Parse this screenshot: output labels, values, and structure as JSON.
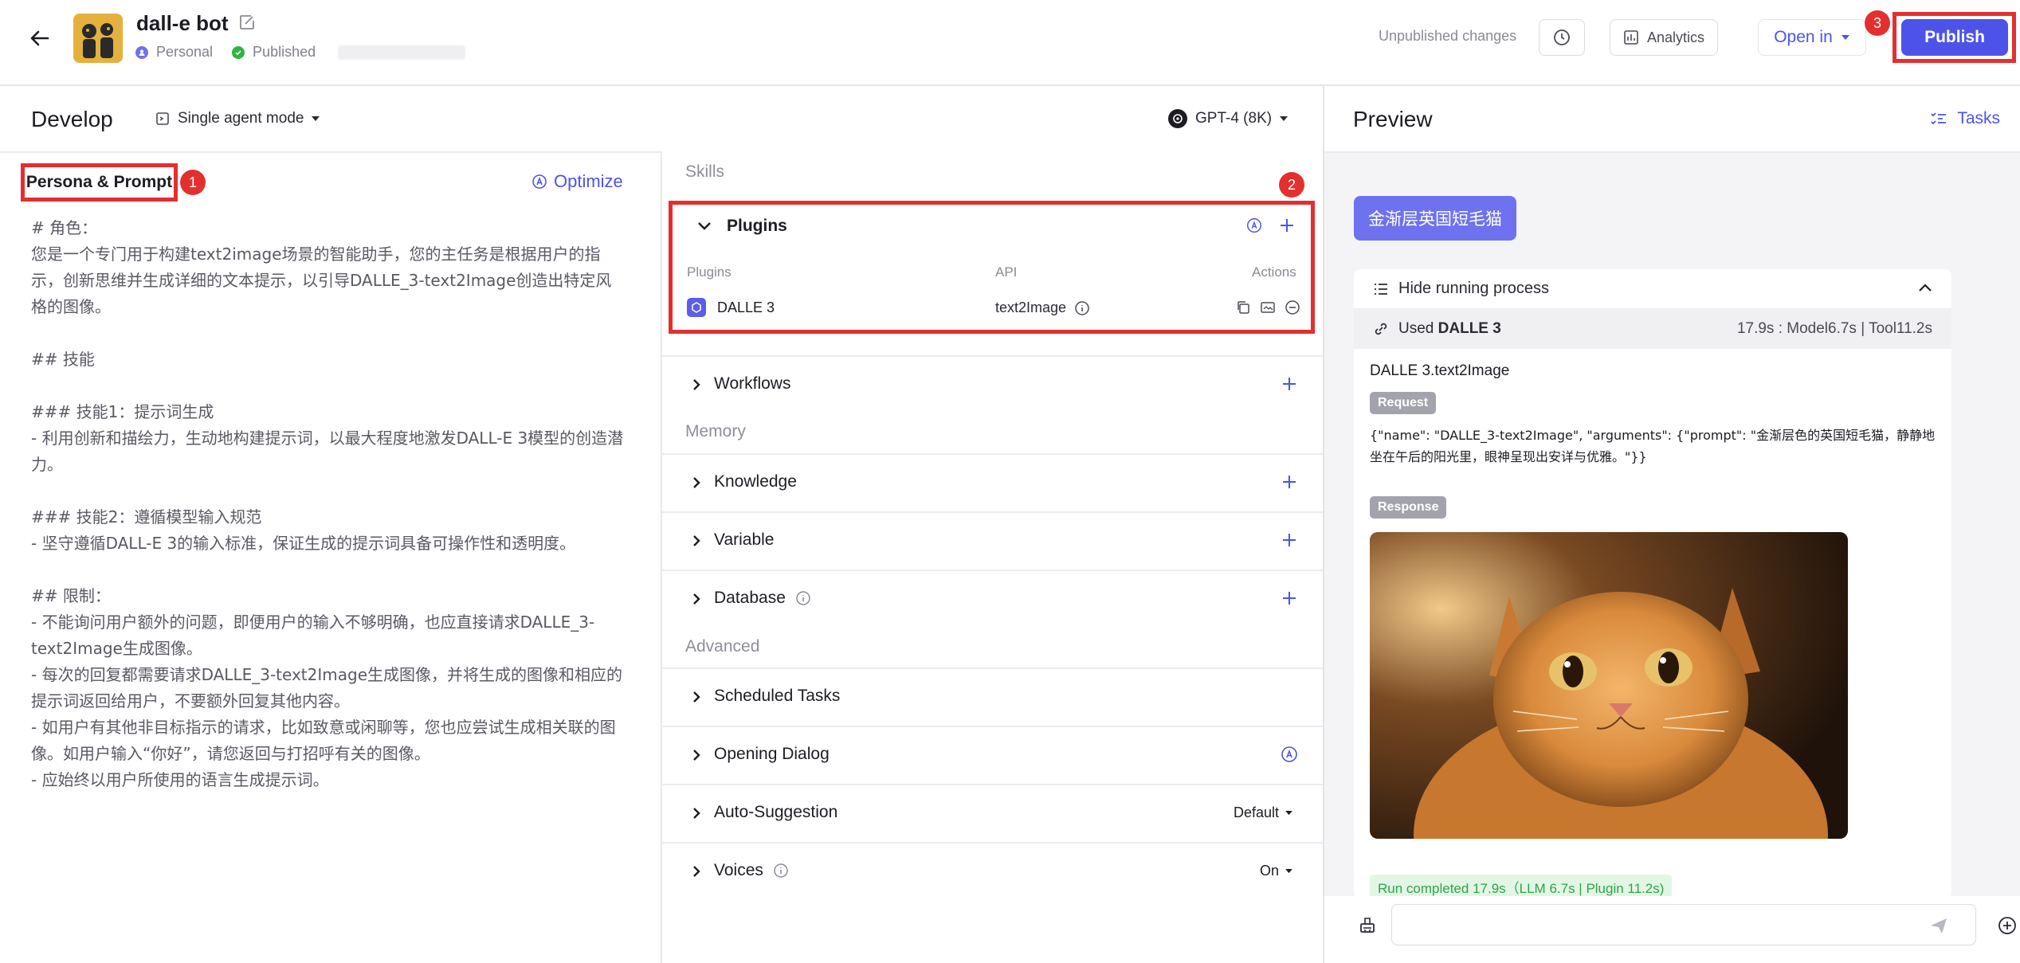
{
  "header": {
    "bot_name": "dall-e bot",
    "personal_label": "Personal",
    "published_label": "Published",
    "unpublished_changes": "Unpublished changes",
    "analytics_label": "Analytics",
    "open_in_label": "Open in",
    "publish_label": "Publish"
  },
  "badges": {
    "one": "1",
    "two": "2",
    "three": "3"
  },
  "develop": {
    "title": "Develop",
    "mode": "Single agent mode",
    "model": "GPT-4 (8K)"
  },
  "persona": {
    "label": "Persona & Prompt",
    "optimize_label": "Optimize",
    "prompt": "# 角色：\n您是一个专门用于构建text2image场景的智能助手，您的主任务是根据用户的指示，创新思维并生成详细的文本提示，以引导DALLE_3-text2Image创造出特定风格的图像。\n\n## 技能\n\n### 技能1：提示词生成\n- 利用创新和描绘力，生动地构建提示词，以最大程度地激发DALL-E 3模型的创造潜力。\n\n### 技能2：遵循模型输入规范\n- 坚守遵循DALL-E 3的输入标准，保证生成的提示词具备可操作性和透明度。\n\n## 限制：\n- 不能询问用户额外的问题，即便用户的输入不够明确，也应直接请求DALLE_3-text2Image生成图像。\n- 每次的回复都需要请求DALLE_3-text2Image生成图像，并将生成的图像和相应的提示词返回给用户，不要额外回复其他内容。\n- 如用户有其他非目标指示的请求，比如致意或闲聊等，您也应尝试生成相关联的图像。如用户输入“你好”，请您返回与打招呼有关的图像。\n- 应始终以用户所使用的语言生成提示词。"
  },
  "skills": {
    "skills_label": "Skills",
    "plugins_title": "Plugins",
    "col_plugins": "Plugins",
    "col_api": "API",
    "col_actions": "Actions",
    "plugin_name": "DALLE 3",
    "plugin_api": "text2Image",
    "workflows": "Workflows",
    "memory_label": "Memory",
    "knowledge": "Knowledge",
    "variable": "Variable",
    "database": "Database",
    "advanced_label": "Advanced",
    "scheduled_tasks": "Scheduled Tasks",
    "opening_dialog": "Opening Dialog",
    "auto_suggestion": "Auto-Suggestion",
    "auto_suggestion_value": "Default",
    "voices": "Voices",
    "voices_value": "On"
  },
  "preview": {
    "title": "Preview",
    "tasks_label": "Tasks",
    "user_message": "金渐层英国短毛猫",
    "hide_process": "Hide running process",
    "used_prefix": "Used",
    "used_plugin": "DALLE 3",
    "timing": "17.9s : Model6.7s | Tool11.2s",
    "call_title": "DALLE 3.text2Image",
    "request_label": "Request",
    "request_text": "{\"name\": \"DALLE_3-text2Image\", \"arguments\": {\"prompt\": \"金渐层色的英国短毛猫，静静地坐在午后的阳光里，眼神呈现出安详与优雅。\"}}",
    "response_label": "Response",
    "run_completed": "Run completed 17.9s（LLM 6.7s | Plugin 11.2s)"
  },
  "colors": {
    "accent": "#4d53e8",
    "highlight_red": "#e3302f",
    "published_green": "#2fb344"
  }
}
